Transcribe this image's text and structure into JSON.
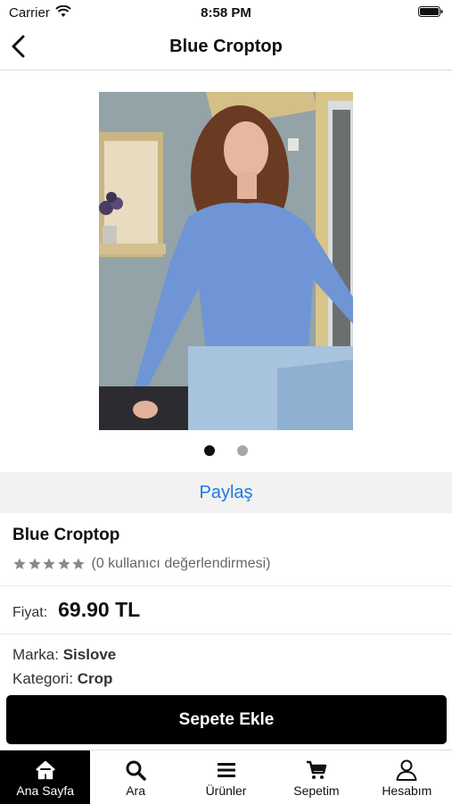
{
  "status_bar": {
    "carrier": "Carrier",
    "time": "8:58 PM"
  },
  "header": {
    "title": "Blue Croptop",
    "back_icon": "chevron-left-icon"
  },
  "gallery": {
    "image_count": 2,
    "current_index": 1
  },
  "share": {
    "label": "Paylaş"
  },
  "product": {
    "name": "Blue Croptop",
    "rating_stars": 5,
    "rating_text": "(0 kullanıcı değerlendirmesi)",
    "price_label": "Fiyat:",
    "price": "69.90 TL",
    "brand_label": "Marka:",
    "brand": "Sislove",
    "category_label": "Kategori:",
    "category": "Crop"
  },
  "actions": {
    "add_to_cart": "Sepete Ekle"
  },
  "tabbar": {
    "tabs": [
      {
        "label": "Ana Sayfa",
        "icon": "home-icon",
        "active": true
      },
      {
        "label": "Ara",
        "icon": "search-icon",
        "active": false
      },
      {
        "label": "Ürünler",
        "icon": "menu-icon",
        "active": false
      },
      {
        "label": "Sepetim",
        "icon": "cart-icon",
        "active": false
      },
      {
        "label": "Hesabım",
        "icon": "user-icon",
        "active": false
      }
    ]
  },
  "colors": {
    "accent": "#1e7be0",
    "button": "#000000",
    "star": "#8a8a8a"
  }
}
